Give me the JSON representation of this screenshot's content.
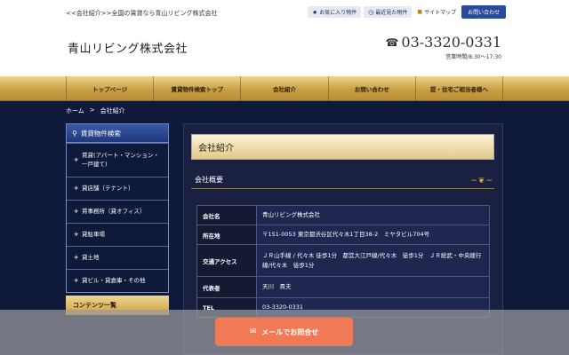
{
  "header": {
    "tagline": "<<会社紹介>>全国の賃貸なら青山リビング株式会社",
    "favorites_label": "お気に入り物件",
    "recent_label": "最近見た物件",
    "sitemap_label": "サイトマップ",
    "contact_label": "お問い合わせ",
    "logo": "青山リビング株式会社",
    "phone": "03-3320-0331",
    "hours": "営業時間/8:30〜17:30"
  },
  "nav": {
    "items": [
      {
        "label": "トップページ"
      },
      {
        "label": "賃貸物件検索トップ"
      },
      {
        "label": "会社紹介"
      },
      {
        "label": "お問い合わせ"
      },
      {
        "label": "提・住宅ご相当者様へ"
      }
    ]
  },
  "breadcrumb": {
    "home": "ホーム",
    "sep": ">",
    "current": "会社紹介"
  },
  "sidebar": {
    "title": "賃貸物件検索",
    "items": [
      {
        "label": "賃貸(アパート・マンション・一戸建て)"
      },
      {
        "label": "貸店舗（テナント）"
      },
      {
        "label": "賃事務所（貸オフィス）"
      },
      {
        "label": "貸駐車場"
      },
      {
        "label": "貸土地"
      },
      {
        "label": "貸ビル・貸倉庫・その他"
      }
    ],
    "second_title": "コンテンツ一覧"
  },
  "main": {
    "title": "会社紹介",
    "subtitle": "会社概要",
    "rows": [
      {
        "label": "会社名",
        "value": "青山リビング株式会社"
      },
      {
        "label": "所在地",
        "value": "〒151-0053 東京都渋谷区代々木1丁目38-2　ミヤタビル704号"
      },
      {
        "label": "交通アクセス",
        "value": "ＪＲ山手線 / 代々木 徒歩1分　都営大江戸線/代々木　徒歩1分　ＪＲ総武・中央緩行線/代々木　徒歩1分"
      },
      {
        "label": "代表者",
        "value": "天川　貴夫"
      },
      {
        "label": "TEL",
        "value": "03-3320-0331"
      }
    ]
  },
  "footer": {
    "mail_button": "メールでお問合せ"
  },
  "colors": {
    "navy": "#0f1a3a",
    "gold": "#c99f45",
    "accent_button": "#f07a55"
  }
}
